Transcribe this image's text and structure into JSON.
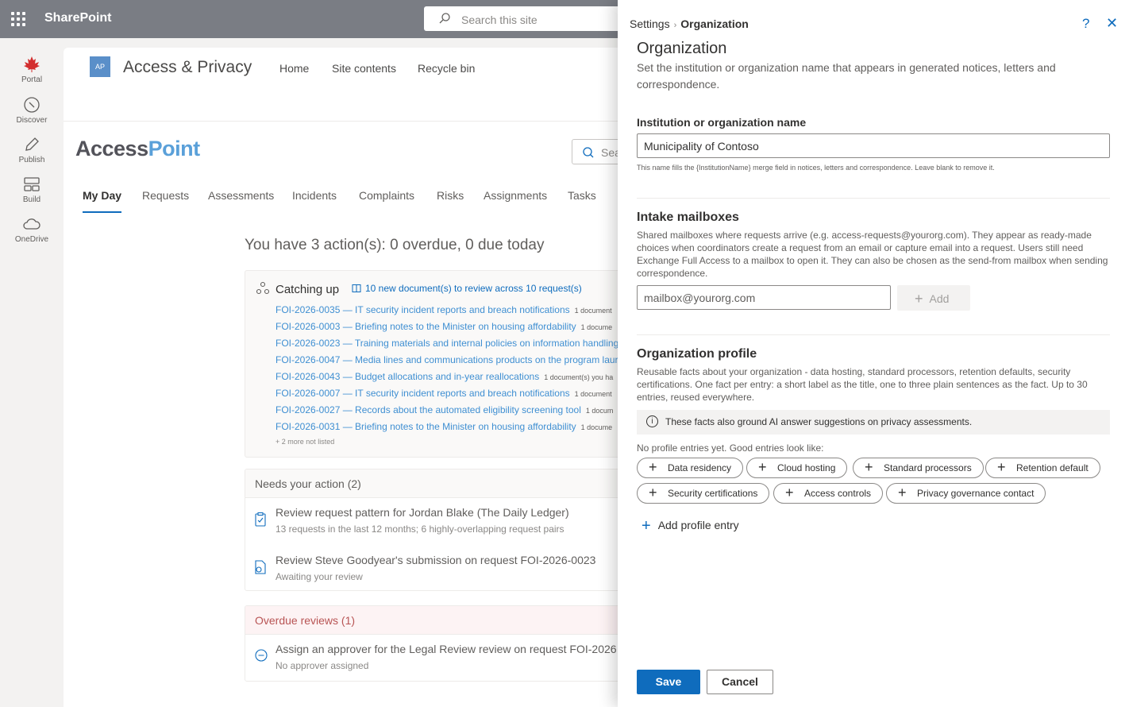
{
  "suite": {
    "brand": "SharePoint",
    "search_placeholder": "Search this site"
  },
  "appbar": [
    {
      "label": "Portal",
      "icon": "maple-leaf-icon"
    },
    {
      "label": "Discover",
      "icon": "compass-icon"
    },
    {
      "label": "Publish",
      "icon": "pen-icon"
    },
    {
      "label": "Build",
      "icon": "layout-icon"
    },
    {
      "label": "OneDrive",
      "icon": "cloud-icon"
    }
  ],
  "site": {
    "icon_text": "AP",
    "title": "Access & Privacy",
    "nav": [
      "Home",
      "Site contents",
      "Recycle bin"
    ],
    "logo_part1": "Access",
    "logo_part2": "Point",
    "search_placeholder": "Sea"
  },
  "tabs": [
    "My Day",
    "Requests",
    "Assessments",
    "Incidents",
    "Complaints",
    "Risks",
    "Assignments",
    "Tasks"
  ],
  "summary": "You have 3 action(s): 0 overdue, 0 due today",
  "catching_up": {
    "title": "Catching up",
    "link": "10 new document(s) to review across 10 request(s)",
    "rows": [
      {
        "text": "FOI-2026-0035 — IT security incident reports and breach notifications",
        "count": "1 document"
      },
      {
        "text": "FOI-2026-0003 — Briefing notes to the Minister on housing affordability",
        "count": "1 docume"
      },
      {
        "text": "FOI-2026-0023 — Training materials and internal policies on information handling",
        "count": ""
      },
      {
        "text": "FOI-2026-0047 — Media lines and communications products on the program laur",
        "count": ""
      },
      {
        "text": "FOI-2026-0043 — Budget allocations and in-year reallocations",
        "count": "1 document(s) you ha"
      },
      {
        "text": "FOI-2026-0007 — IT security incident reports and breach notifications",
        "count": "1 document"
      },
      {
        "text": "FOI-2026-0027 — Records about the automated eligibility screening tool",
        "count": "1 docum"
      },
      {
        "text": "FOI-2026-0031 — Briefing notes to the Minister on housing affordability",
        "count": "1 docume"
      }
    ],
    "more": "+ 2 more not listed"
  },
  "needs_action": {
    "title": "Needs your action (2)",
    "items": [
      {
        "title": "Review request pattern for Jordan Blake (The Daily Ledger)",
        "sub": "13 requests in the last 12 months; 6 highly-overlapping request pairs"
      },
      {
        "title": "Review Steve Goodyear's submission on request FOI-2026-0023",
        "sub": "Awaiting your review"
      }
    ]
  },
  "overdue": {
    "title": "Overdue reviews (1)",
    "item": {
      "title": "Assign an approver for the Legal Review review on request FOI-2026",
      "sub": "No approver assigned"
    }
  },
  "panel": {
    "breadcrumb_root": "Settings",
    "breadcrumb_current": "Organization",
    "title": "Organization",
    "description": "Set the institution or organization name that appears in generated notices, letters and correspondence.",
    "name_label": "Institution or organization name",
    "name_value": "Municipality of Contoso",
    "name_hint": "This name fills the {InstitutionName} merge field in notices, letters and correspondence. Leave blank to remove it.",
    "mailboxes_title": "Intake mailboxes",
    "mailboxes_desc": "Shared mailboxes where requests arrive (e.g. access-requests@yourorg.com). They appear as ready-made choices when coordinators create a request from an email or capture email into a request. Users still need Exchange Full Access to a mailbox to open it. They can also be chosen as the send-from mailbox when sending correspondence.",
    "mailbox_placeholder": "mailbox@yourorg.com",
    "add_label": "Add",
    "profile_title": "Organization profile",
    "profile_desc": "Reusable facts about your organization - data hosting, standard processors, retention defaults, security certifications. One fact per entry: a short label as the title, one to three plain sentences as the fact. Up to 30 entries, reused everywhere.",
    "info_text": "These facts also ground AI answer suggestions on privacy assessments.",
    "empty_text": "No profile entries yet. Good entries look like:",
    "chips": [
      "Data residency",
      "Cloud hosting",
      "Standard processors",
      "Retention default",
      "Security certifications",
      "Access controls",
      "Privacy governance contact"
    ],
    "add_profile": "Add profile entry",
    "save": "Save",
    "cancel": "Cancel"
  }
}
